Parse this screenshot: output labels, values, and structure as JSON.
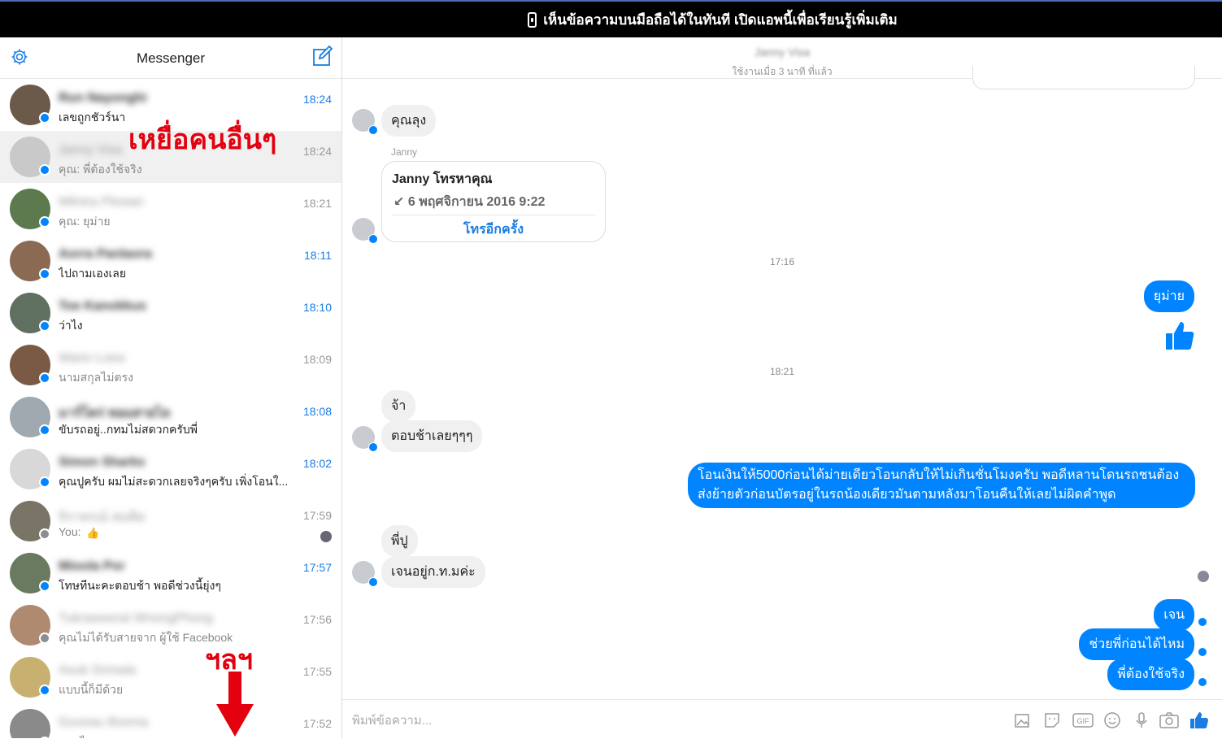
{
  "banner": {
    "text": "เห็นข้อความบนมือถือได้ในทันที เปิดแอพนี้เพื่อเรียนรู้เพิ่มเติม"
  },
  "sidebar": {
    "title": "Messenger",
    "conversations": [
      {
        "name": "Run Nayonghi",
        "snippet": "เลขถูกชัวร์นา",
        "time": "18:24",
        "unread": true,
        "badge": "messenger"
      },
      {
        "name": "Janny Visa",
        "snippet": "คุณ: พี่ต้องใช้จริง",
        "time": "18:24",
        "unread": false,
        "badge": "messenger"
      },
      {
        "name": "Milntra Plewan",
        "snippet": "คุณ: ยุม่าย",
        "time": "18:21",
        "unread": false,
        "badge": "messenger"
      },
      {
        "name": "Aorra Panlaora",
        "snippet": "ไปถามเองเลย",
        "time": "18:11",
        "unread": true,
        "badge": "messenger"
      },
      {
        "name": "Toe Kanokkus",
        "snippet": "ว่าไง",
        "time": "18:10",
        "unread": true,
        "badge": "messenger"
      },
      {
        "name": "Warin Loea",
        "snippet": "นามสกุลไม่ตรง",
        "time": "18:09",
        "unread": false,
        "badge": "messenger"
      },
      {
        "name": "มาร์โคร่ หอมสายไล",
        "snippet": "ขับรถอยู่..กทมไม่สดวกครับพี่",
        "time": "18:08",
        "unread": true,
        "badge": "messenger"
      },
      {
        "name": "Simon Sharks",
        "snippet": "คุณปูครับ ผมไม่สะดวกเลยจริงๆครับ เพิ่งโอนใ...",
        "time": "18:02",
        "unread": true,
        "badge": "messenger"
      },
      {
        "name": "จิราพรณ์ สมคิด",
        "snippet": "You: ",
        "time": "17:59",
        "unread": false,
        "badge": "facebook"
      },
      {
        "name": "Mioola Por",
        "snippet": "โทษทีนะคะตอบช้า พอดีช่วงนี้ยุ่งๆ",
        "time": "17:57",
        "unread": true,
        "badge": "messenger"
      },
      {
        "name": "Tukraweerat WnongPhong",
        "snippet": "คุณไม่ได้รับสายจาก ผู้ใช้ Facebook",
        "time": "17:56",
        "unread": false,
        "badge": "facebook"
      },
      {
        "name": "Asub Srimala",
        "snippet": "แบบนี้ก็มีด้วย",
        "time": "17:55",
        "unread": false,
        "badge": "messenger"
      },
      {
        "name": "Guveau Bsoma",
        "snippet": "ถอนไหม",
        "time": "17:52",
        "unread": false,
        "badge": "messenger"
      }
    ]
  },
  "annotations": {
    "others": "เหยื่อคนอื่นๆ",
    "etc": "ฯลฯ"
  },
  "chat": {
    "header_name": "Janny Visa",
    "header_status": "ใช้งานเมื่อ 3 นาที ที่แล้ว",
    "messages": {
      "m1": "คุณลุง",
      "sender": "Janny",
      "call_title": "Janny โทรหาคุณ",
      "call_date": "↙ 6 พฤศจิกายน 2016 9:22",
      "call_back": "โทรอีกครั้ง",
      "ts1": "17:16",
      "m2": "ยุม่าย",
      "ts2": "18:21",
      "m3": "จ้า",
      "m4": "ตอบช้าเลยๆๆๆ",
      "m5": "โอนเงินให้5000ก่อนได้ม่ายเดียวโอนกลับให้ไม่เกินชั่นโมงครับ พอดีหลานโดนรถชนต้องส่งย้ายตัวก่อนบัตรอยู่ในรถน้องเดียวมันตามหลังมาโอนคืนให้เลยไม่ผิดคำพูด",
      "m6": "พี่ปู",
      "m7": "เจนอยู่ก.ท.มค่ะ",
      "m8": "เจน",
      "m9": "ช่วยพี่ก่อนได้ไหม",
      "m10": "พี่ต้องใช้จริง"
    },
    "composer_placeholder": "พิมพ์ข้อความ..."
  },
  "colors": {
    "accent": "#0084ff",
    "banner": "#000000",
    "annotation": "#e3000f"
  }
}
